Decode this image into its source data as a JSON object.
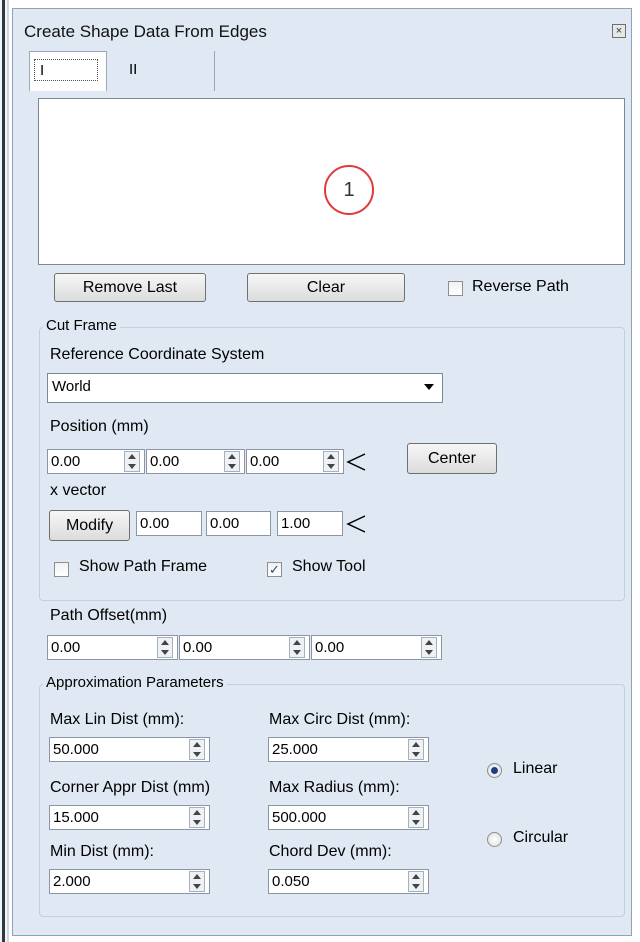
{
  "window": {
    "title": "Create Shape Data From Edges"
  },
  "tabs": [
    "I",
    "II"
  ],
  "canvas": {
    "marker": "1"
  },
  "buttons": {
    "remove_last": "Remove Last",
    "clear": "Clear",
    "center": "Center",
    "modify": "Modify"
  },
  "reverse_path": {
    "label": "Reverse Path",
    "checked": false
  },
  "cut_frame": {
    "caption": "Cut Frame",
    "ref_label": "Reference Coordinate System",
    "ref_value": "World",
    "position_label": "Position (mm)",
    "position": [
      "0.00",
      "0.00",
      "0.00"
    ],
    "xvector_label": "x vector",
    "xvector": [
      "0.00",
      "0.00",
      "1.00"
    ],
    "show_path_frame": {
      "label": "Show Path Frame",
      "checked": false
    },
    "show_tool": {
      "label": "Show Tool",
      "checked": true
    }
  },
  "path_offset": {
    "label": "Path Offset(mm)",
    "values": [
      "0.00",
      "0.00",
      "0.00"
    ]
  },
  "approx": {
    "caption": "Approximation Parameters",
    "max_lin_label": "Max Lin Dist (mm):",
    "max_lin": "50.000",
    "max_circ_label": "Max Circ Dist (mm):",
    "max_circ": "25.000",
    "corner_label": "Corner Appr Dist (mm)",
    "corner": "15.000",
    "max_radius_label": "Max Radius (mm):",
    "max_radius": "500.000",
    "min_dist_label": "Min Dist (mm):",
    "min_dist": "2.000",
    "chord_label": "Chord Dev (mm):",
    "chord": "0.050",
    "linear_label": "Linear",
    "circular_label": "Circular",
    "selected": "Linear"
  },
  "colors": {
    "panel": "#dfe8f3",
    "marker": "#e03a3a",
    "radio_dot": "#1d3f83"
  }
}
